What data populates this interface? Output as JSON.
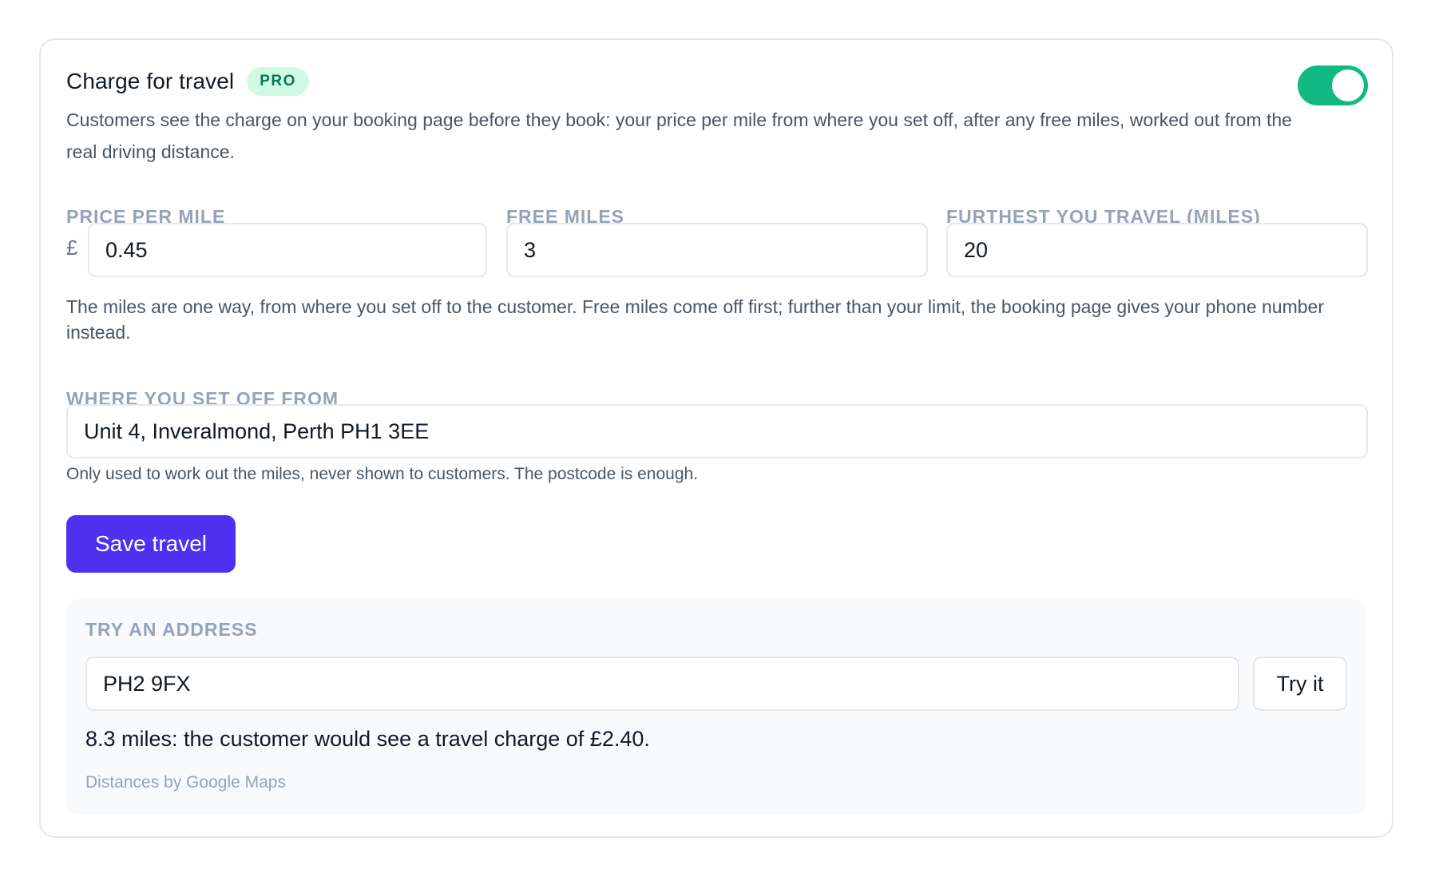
{
  "travel": {
    "title": "Charge for travel",
    "badge": "PRO",
    "enabled": true,
    "description": "Customers see the charge on your booking page before they book: your price per mile from where you set off, after any free miles, worked out from the real driving distance.",
    "price_per_mile": {
      "label": "PRICE PER MILE",
      "currency": "£",
      "value": "0.45"
    },
    "free_miles": {
      "label": "FREE MILES",
      "value": "3"
    },
    "max_distance": {
      "label": "FURTHEST YOU TRAVEL (MILES)",
      "value": "20"
    },
    "miles_note": "The miles are one way, from where you set off to the customer. Free miles come off first; further than your limit, the booking page gives your phone number instead.",
    "origin": {
      "label": "WHERE YOU SET OFF FROM",
      "value": "Unit 4, Inveralmond, Perth PH1 3EE",
      "help": "Only used to work out the miles, never shown to customers. The postcode is enough."
    },
    "save_label": "Save travel",
    "colors": {
      "accent": "#4f2ff0",
      "toggle_on": "#10b981",
      "badge_bg": "#d1fae5",
      "badge_text": "#047857"
    }
  },
  "try_address": {
    "label": "TRY AN ADDRESS",
    "value": "PH2 9FX",
    "button_label": "Try it",
    "result": "8.3 miles: the customer would see a travel charge of £2.40.",
    "attribution": "Distances by Google Maps"
  }
}
